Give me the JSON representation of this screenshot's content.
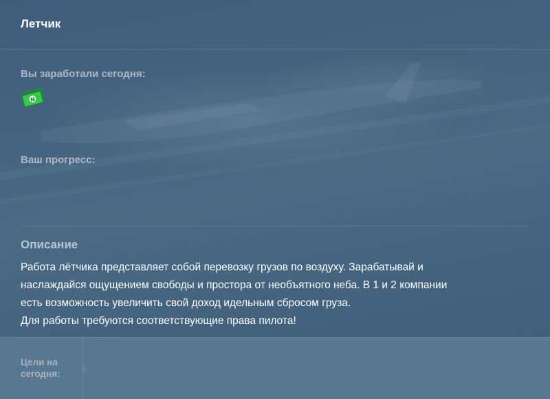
{
  "window": {
    "title": "Летчик"
  },
  "earnings": {
    "label": "Вы заработали сегодня:",
    "icon": "money-icon"
  },
  "progress": {
    "label": "Ваш прогресс:"
  },
  "description": {
    "title": "Описание",
    "lines": [
      "Работа лётчика представляет собой перевозку грузов по воздуху. Зарабатывай и",
      "наслаждайся ощущением свободы и простора от необъятного неба. В 1 и 2 компании",
      "есть возможность увеличить свой доход идельным сбросом груза.",
      "Для работы требуются соответствующие права пилота!"
    ]
  },
  "goals": {
    "label_line1": "Цели на",
    "label_line2": "сегодня:"
  },
  "colors": {
    "background": "#44637f",
    "footer": "#587790",
    "money_green": "#34c24a"
  }
}
